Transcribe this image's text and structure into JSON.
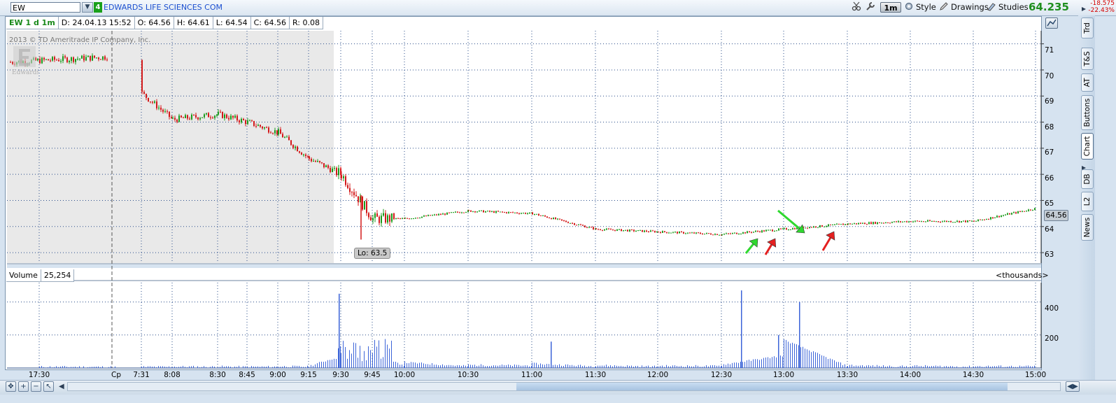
{
  "symbol": {
    "value": "EW",
    "link_number": "4",
    "company": "EDWARDS LIFE SCIENCES COM"
  },
  "toolbar": {
    "period": "1m",
    "style_label": "Style",
    "drawings_label": "Drawings",
    "studies_label": "Studies",
    "last_price": "64.235",
    "net_change": "-18.575",
    "net_change_pct": "-22.43%"
  },
  "info_bar": {
    "title": "EW 1 d 1m",
    "date": "D: 24.04.13 15:52",
    "open": "O: 64.56",
    "high": "H: 64.61",
    "low": "L: 64.54",
    "close": "C: 64.56",
    "range": "R: 0.08"
  },
  "watermark": {
    "copyright": "2013 © TD Ameritrade IP Company, Inc.",
    "logo_text": "Edwards"
  },
  "low_marker": "Lo: 63.5",
  "current_price_tag": "64.56",
  "price_axis": [
    "71",
    "70",
    "69",
    "68",
    "67",
    "66",
    "65",
    "64",
    "63"
  ],
  "volume_panel": {
    "label": "Volume",
    "value": "25,254",
    "units": "<thousands>",
    "axis": [
      "400",
      "200"
    ]
  },
  "time_axis": [
    "17:30",
    "Cp",
    "7:31",
    "8:08",
    "8:30",
    "8:45",
    "9:00",
    "9:15",
    "9:30",
    "9:45",
    "10:00",
    "10:30",
    "11:00",
    "11:30",
    "12:00",
    "12:30",
    "13:00",
    "13:30",
    "14:00",
    "14:30",
    "15:00"
  ],
  "right_tabs": [
    "Trd",
    "T&S",
    "AT",
    "Buttons",
    "Chart",
    "DB",
    "L2",
    "News"
  ],
  "active_tab": "Chart",
  "colors": {
    "up": "#1a9a1a",
    "down": "#d31a1a",
    "grid": "#2a4d8a",
    "volume": "#3c64d8",
    "premarket_bg": "#e9e9e9",
    "arrow_green": "#2fd82f",
    "arrow_red": "#e42020"
  },
  "annotations": [
    {
      "type": "arrow",
      "color": "green",
      "direction": "up-right",
      "note": "first green arrow near 12:45"
    },
    {
      "type": "arrow",
      "color": "red",
      "direction": "up-right",
      "note": "red arrow near 12:55"
    },
    {
      "type": "arrow",
      "color": "green",
      "direction": "down-right",
      "note": "green arrow near 13:10"
    },
    {
      "type": "arrow",
      "color": "red",
      "direction": "up-right",
      "note": "red arrow near 13:25"
    }
  ],
  "chart_data": {
    "type": "line",
    "title": "EW 1 d 1m",
    "ylim": [
      62.6,
      71.5
    ],
    "yticks": [
      63,
      64,
      65,
      66,
      67,
      68,
      69,
      70,
      71
    ],
    "x": [
      "17:30",
      "Cp",
      "7:31",
      "8:08",
      "8:30",
      "8:45",
      "9:00",
      "9:15",
      "9:30",
      "9:45",
      "10:00",
      "10:30",
      "11:00",
      "11:30",
      "12:00",
      "12:30",
      "13:00",
      "13:30",
      "14:00",
      "14:30",
      "15:00"
    ],
    "series": [
      {
        "values": [
          70.3,
          70.5,
          69.1,
          68.1,
          68.3,
          68.0,
          67.6,
          66.6,
          66.0,
          64.3,
          64.3,
          64.6,
          64.5,
          63.9,
          63.8,
          63.7,
          63.9,
          64.1,
          64.2,
          64.2,
          64.7
        ]
      }
    ],
    "volume": {
      "ylim": [
        0,
        500
      ],
      "values": [
        5,
        3,
        4,
        8,
        10,
        6,
        12,
        15,
        450,
        180,
        80,
        35,
        60,
        30,
        20,
        40,
        470,
        30,
        20,
        15,
        25
      ]
    },
    "low": 63.5,
    "last": 64.56
  }
}
